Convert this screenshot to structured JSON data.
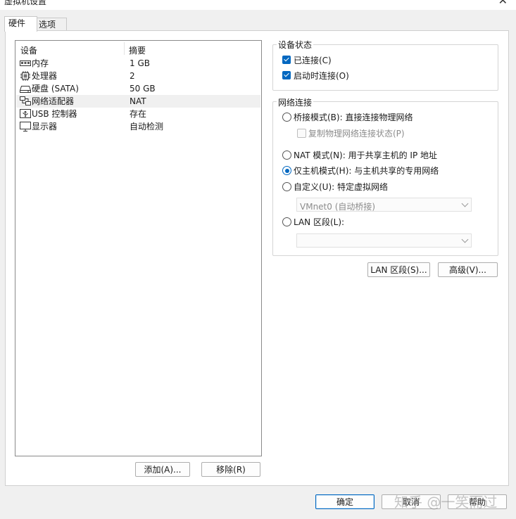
{
  "window": {
    "title": "虚拟机设置",
    "close_icon": "close-icon"
  },
  "tabs": [
    {
      "label": "硬件"
    },
    {
      "label": "选项"
    }
  ],
  "device_list": {
    "headers": {
      "device": "设备",
      "summary": "摘要"
    },
    "rows": [
      {
        "name": "内存",
        "summary": "1 GB",
        "icon": "memory-icon"
      },
      {
        "name": "处理器",
        "summary": "2",
        "icon": "cpu-icon"
      },
      {
        "name": "硬盘 (SATA)",
        "summary": "50 GB",
        "icon": "harddisk-icon"
      },
      {
        "name": "网络适配器",
        "summary": "NAT",
        "icon": "network-adapter-icon",
        "selected": true
      },
      {
        "name": "USB 控制器",
        "summary": "存在",
        "icon": "usb-icon"
      },
      {
        "name": "显示器",
        "summary": "自动检测",
        "icon": "monitor-icon"
      }
    ]
  },
  "list_buttons": {
    "add": "添加(A)...",
    "remove": "移除(R)"
  },
  "device_status": {
    "title": "设备状态",
    "connected": {
      "label": "已连接(C)",
      "checked": true
    },
    "connect_on_poweron": {
      "label": "启动时连接(O)",
      "checked": true
    }
  },
  "network": {
    "title": "网络连接",
    "bridged": "桥接模式(B): 直接连接物理网络",
    "replicate": "复制物理网络连接状态(P)",
    "nat": "NAT 模式(N): 用于共享主机的 IP 地址",
    "hostonly": "仅主机模式(H): 与主机共享的专用网络",
    "custom": "自定义(U): 特定虚拟网络",
    "custom_select": "VMnet0 (自动桥接)",
    "lan": "LAN 区段(L):",
    "lan_select": "",
    "selected": "hostonly"
  },
  "side_buttons": {
    "lan_segments": "LAN 区段(S)...",
    "advanced": "高级(V)..."
  },
  "dialog_buttons": {
    "ok": "确定",
    "cancel": "取消",
    "help": "帮助"
  },
  "watermark": "知乎 @一笑而过",
  "colors": {
    "accent": "#0067c0"
  }
}
